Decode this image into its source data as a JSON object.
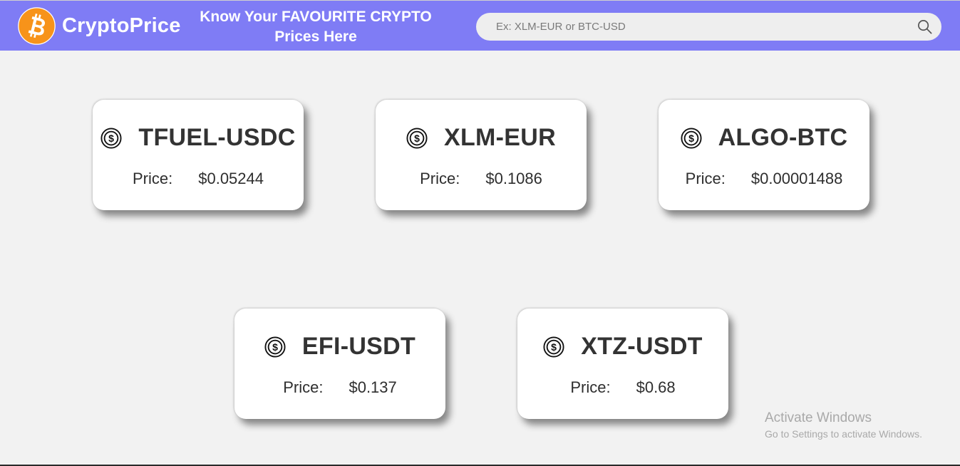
{
  "header": {
    "brand": "CryptoPrice",
    "tagline_line1": "Know Your FAVOURITE CRYPTO",
    "tagline_line2": "Prices Here",
    "logo_icon": "bitcoin-logo-icon",
    "logo_color": "#f7931a",
    "bar_color": "#7f7cf5"
  },
  "search": {
    "placeholder": "Ex: XLM-EUR or BTC-USD",
    "value": "",
    "icon": "search-icon"
  },
  "cards": [
    {
      "pair": "TFUEL-USDC",
      "price_label": "Price:",
      "price": "$0.05244",
      "icon": "dollar-coin-icon"
    },
    {
      "pair": "XLM-EUR",
      "price_label": "Price:",
      "price": "$0.1086",
      "icon": "dollar-coin-icon"
    },
    {
      "pair": "ALGO-BTC",
      "price_label": "Price:",
      "price": "$0.00001488",
      "icon": "dollar-coin-icon"
    },
    {
      "pair": "EFI-USDT",
      "price_label": "Price:",
      "price": "$0.137",
      "icon": "dollar-coin-icon"
    },
    {
      "pair": "XTZ-USDT",
      "price_label": "Price:",
      "price": "$0.68",
      "icon": "dollar-coin-icon"
    }
  ],
  "watermark": {
    "title": "Activate Windows",
    "subtitle": "Go to Settings to activate Windows."
  }
}
